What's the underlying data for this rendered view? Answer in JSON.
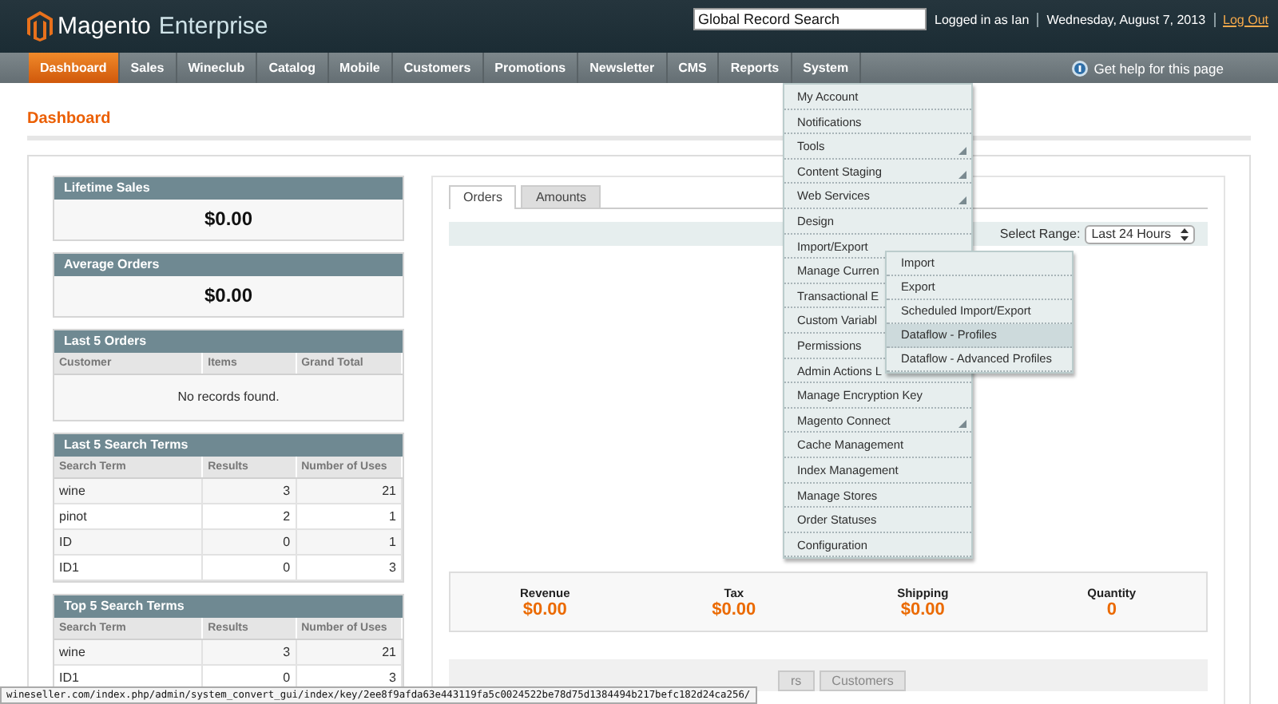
{
  "header": {
    "logo_brand": "Magento",
    "logo_edition": "Enterprise",
    "search": {
      "placeholder": "Global Record Search"
    },
    "user": "Logged in as Ian",
    "date": "Wednesday, August 7, 2013",
    "logout": "Log Out"
  },
  "nav": [
    {
      "label": "Dashboard",
      "selected": true
    },
    {
      "label": "Sales",
      "selected": false
    },
    {
      "label": "Wineclub",
      "selected": false
    },
    {
      "label": "Catalog",
      "selected": false
    },
    {
      "label": "Mobile",
      "selected": false
    },
    {
      "label": "Customers",
      "selected": false
    },
    {
      "label": "Promotions",
      "selected": false
    },
    {
      "label": "Newsletter",
      "selected": false
    },
    {
      "label": "CMS",
      "selected": false
    },
    {
      "label": "Reports",
      "selected": false
    },
    {
      "label": "System",
      "selected": false
    }
  ],
  "help": "Get help for this page",
  "system_menu": [
    {
      "label": "My Account",
      "has_children": false
    },
    {
      "label": "Notifications",
      "has_children": false
    },
    {
      "label": "Tools",
      "has_children": true
    },
    {
      "label": "Content Staging",
      "has_children": true
    },
    {
      "label": "Web Services",
      "has_children": true
    },
    {
      "label": "Design",
      "has_children": false
    },
    {
      "label": "Import/Export",
      "has_children": false
    },
    {
      "label": "Manage Curren",
      "has_children": false
    },
    {
      "label": "Transactional E",
      "has_children": false
    },
    {
      "label": "Custom Variabl",
      "has_children": false
    },
    {
      "label": "Permissions",
      "has_children": false
    },
    {
      "label": "Admin Actions L",
      "has_children": false
    },
    {
      "label": "Manage Encryption Key",
      "has_children": false
    },
    {
      "label": "Magento Connect",
      "has_children": true
    },
    {
      "label": "Cache Management",
      "has_children": false
    },
    {
      "label": "Index Management",
      "has_children": false
    },
    {
      "label": "Manage Stores",
      "has_children": false
    },
    {
      "label": "Order Statuses",
      "has_children": false
    },
    {
      "label": "Configuration",
      "has_children": false
    }
  ],
  "import_export_submenu": [
    {
      "label": "Import",
      "selected": false
    },
    {
      "label": "Export",
      "selected": false
    },
    {
      "label": "Scheduled Import/Export",
      "selected": false
    },
    {
      "label": "Dataflow - Profiles",
      "selected": true
    },
    {
      "label": "Dataflow - Advanced Profiles",
      "selected": false
    }
  ],
  "page_title": "Dashboard",
  "lifetime_sales": {
    "title": "Lifetime Sales",
    "value": "$0.00"
  },
  "average_orders": {
    "title": "Average Orders",
    "value": "$0.00"
  },
  "last_orders": {
    "title": "Last 5 Orders",
    "columns": [
      "Customer",
      "Items",
      "Grand Total"
    ],
    "empty": "No records found."
  },
  "last_search_terms": {
    "title": "Last 5 Search Terms",
    "columns": [
      "Search Term",
      "Results",
      "Number of Uses"
    ],
    "rows": [
      [
        "wine",
        "3",
        "21"
      ],
      [
        "pinot",
        "2",
        "1"
      ],
      [
        "ID",
        "0",
        "1"
      ],
      [
        "ID1",
        "0",
        "3"
      ]
    ]
  },
  "top_search_terms": {
    "title": "Top 5 Search Terms",
    "columns": [
      "Search Term",
      "Results",
      "Number of Uses"
    ],
    "rows": [
      [
        "wine",
        "3",
        "21"
      ],
      [
        "ID1",
        "0",
        "3"
      ]
    ]
  },
  "chart_tabs": [
    {
      "label": "Orders",
      "selected": true
    },
    {
      "label": "Amounts",
      "selected": false
    }
  ],
  "range": {
    "label": "Select Range:",
    "value": "Last 24 Hours"
  },
  "totals": [
    {
      "label": "Revenue",
      "value": "$0.00"
    },
    {
      "label": "Tax",
      "value": "$0.00"
    },
    {
      "label": "Shipping",
      "value": "$0.00"
    },
    {
      "label": "Quantity",
      "value": "0"
    }
  ],
  "bottom_tabs": [
    {
      "label": "rs",
      "selected": false
    },
    {
      "label": "Customers",
      "selected": false
    }
  ],
  "status_url": "wineseller.com/index.php/admin/system_convert_gui/index/key/2ee8f9afda63e443119fa5c0024522be78d75d1384494b217befc182d24ca256/"
}
